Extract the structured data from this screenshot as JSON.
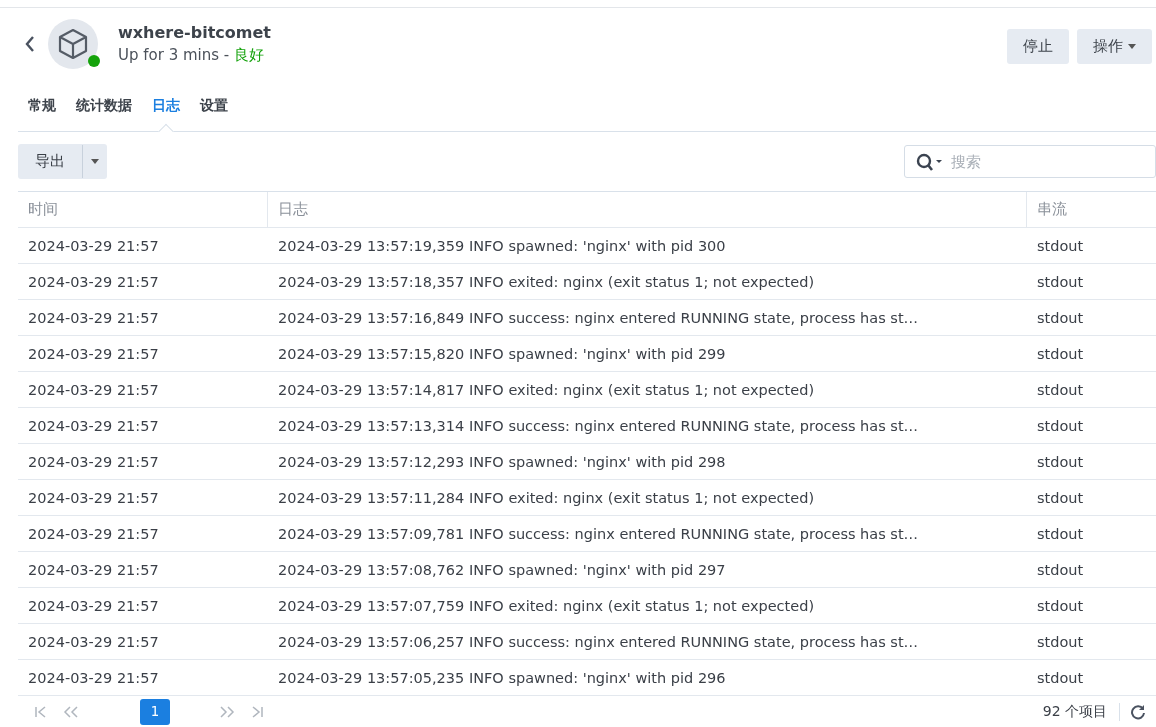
{
  "header": {
    "title": "wxhere-bitcomet",
    "uptime": "Up for 3 mins - ",
    "health": "良好",
    "running": true
  },
  "header_buttons": [
    {
      "label": "停止",
      "dropdown": false
    },
    {
      "label": "操作",
      "dropdown": true
    }
  ],
  "tabs": [
    {
      "label": "常规",
      "selected": false
    },
    {
      "label": "统计数据",
      "selected": false
    },
    {
      "label": "日志",
      "selected": true
    },
    {
      "label": "设置",
      "selected": false
    }
  ],
  "toolbar": {
    "export": "导出",
    "search": {
      "placeholder": "搜索"
    }
  },
  "table": {
    "columns": [
      "时间",
      "日志",
      "串流"
    ],
    "rows": [
      [
        "2024-03-29 21:57",
        "2024-03-29 13:57:19,359 INFO spawned: 'nginx' with pid 300",
        "stdout"
      ],
      [
        "2024-03-29 21:57",
        "2024-03-29 13:57:18,357 INFO exited: nginx (exit status 1; not expected)",
        "stdout"
      ],
      [
        "2024-03-29 21:57",
        "2024-03-29 13:57:16,849 INFO success: nginx entered RUNNING state, process has st…",
        "stdout"
      ],
      [
        "2024-03-29 21:57",
        "2024-03-29 13:57:15,820 INFO spawned: 'nginx' with pid 299",
        "stdout"
      ],
      [
        "2024-03-29 21:57",
        "2024-03-29 13:57:14,817 INFO exited: nginx (exit status 1; not expected)",
        "stdout"
      ],
      [
        "2024-03-29 21:57",
        "2024-03-29 13:57:13,314 INFO success: nginx entered RUNNING state, process has st…",
        "stdout"
      ],
      [
        "2024-03-29 21:57",
        "2024-03-29 13:57:12,293 INFO spawned: 'nginx' with pid 298",
        "stdout"
      ],
      [
        "2024-03-29 21:57",
        "2024-03-29 13:57:11,284 INFO exited: nginx (exit status 1; not expected)",
        "stdout"
      ],
      [
        "2024-03-29 21:57",
        "2024-03-29 13:57:09,781 INFO success: nginx entered RUNNING state, process has st…",
        "stdout"
      ],
      [
        "2024-03-29 21:57",
        "2024-03-29 13:57:08,762 INFO spawned: 'nginx' with pid 297",
        "stdout"
      ],
      [
        "2024-03-29 21:57",
        "2024-03-29 13:57:07,759 INFO exited: nginx (exit status 1; not expected)",
        "stdout"
      ],
      [
        "2024-03-29 21:57",
        "2024-03-29 13:57:06,257 INFO success: nginx entered RUNNING state, process has st…",
        "stdout"
      ],
      [
        "2024-03-29 21:57",
        "2024-03-29 13:57:05,235 INFO spawned: 'nginx' with pid 296",
        "stdout"
      ]
    ]
  },
  "pagination": {
    "pages": [
      {
        "label": "1",
        "selected": true
      }
    ],
    "count": "92 个项目"
  }
}
